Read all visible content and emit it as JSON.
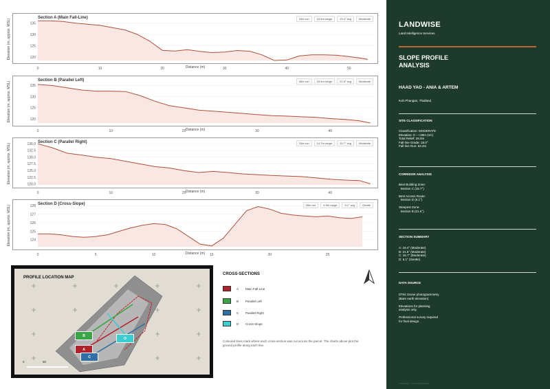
{
  "chart_data": [
    {
      "type": "area",
      "title": "Section A (Main Fall-Line)",
      "xlabel": "Distance (m)",
      "ylabel": "Elevation (m, approx. MSL)",
      "xlim": [
        0,
        54
      ],
      "ylim": [
        118.5,
        137
      ],
      "xticks": [
        0,
        10,
        20,
        30,
        40,
        50
      ],
      "yticks": [
        120,
        125,
        130,
        135
      ],
      "badges": [
        "33m run",
        "18.5m range",
        "19.4° avg",
        "Moderate"
      ],
      "x": [
        0,
        2,
        4,
        6,
        8,
        10,
        12,
        14,
        16,
        18,
        20,
        22,
        24,
        26,
        28,
        30,
        32,
        34,
        36,
        38,
        40,
        42,
        44,
        46,
        48,
        50,
        52,
        53
      ],
      "y": [
        136,
        136,
        135.7,
        135,
        134.5,
        134,
        133,
        132,
        130,
        127,
        123,
        122.7,
        123.3,
        122.5,
        122,
        122.2,
        122.9,
        122.6,
        121,
        118.5,
        118.7,
        120.5,
        121,
        121,
        120.8,
        120.2,
        119.5,
        119
      ]
    },
    {
      "type": "area",
      "title": "Section B (Parallel Left)",
      "xlabel": "Distance (m)",
      "ylabel": "Elevation (m, approx. MSL)",
      "xlim": [
        0,
        46
      ],
      "ylim": [
        118.2,
        137
      ],
      "xticks": [
        0,
        10,
        20,
        30,
        40
      ],
      "yticks": [
        120,
        125,
        130,
        135
      ],
      "badges": [
        "46m run",
        "18.4m range",
        "21.6° avg",
        "Moderate"
      ],
      "x": [
        0,
        2,
        4,
        6,
        8,
        10,
        12,
        14,
        16,
        18,
        20,
        22,
        24,
        26,
        28,
        30,
        32,
        34,
        36,
        38,
        40,
        42,
        44,
        45.5
      ],
      "y": [
        135.5,
        135,
        134,
        133,
        132.5,
        132.5,
        132.3,
        130.5,
        128,
        126,
        125,
        124,
        123.5,
        123,
        122.5,
        122,
        121.5,
        121.3,
        121,
        120.8,
        120.2,
        119.8,
        119.2,
        118.2
      ]
    },
    {
      "type": "area",
      "title": "Section C (Parallel Right)",
      "xlabel": "Distance (m)",
      "ylabel": "Elevation (m, approx. MSL)",
      "xlim": [
        0,
        46
      ],
      "ylim": [
        119.7,
        135.3
      ],
      "xticks": [
        0,
        10,
        20,
        30,
        40
      ],
      "yticks": [
        120.0,
        122.5,
        125.0,
        127.5,
        130.0,
        132.5,
        135.0
      ],
      "badges": [
        "33m run",
        "14.7m range",
        "15.7° avg",
        "Moderate"
      ],
      "x": [
        0,
        2,
        4,
        6,
        8,
        10,
        12,
        14,
        16,
        18,
        20,
        22,
        24,
        26,
        28,
        30,
        32,
        34,
        36,
        38,
        40,
        42,
        44,
        45.5
      ],
      "y": [
        135,
        133.5,
        131.5,
        130.8,
        130,
        129.5,
        128.5,
        127.5,
        126.5,
        126,
        125,
        124.3,
        124.7,
        124.3,
        123.8,
        123.5,
        123.2,
        123,
        122.8,
        122.3,
        121.8,
        121.5,
        121.3,
        120.1
      ]
    },
    {
      "type": "area",
      "title": "Section D (Cross-Slope)",
      "xlabel": "Distance (m)",
      "ylabel": "Elevation (m, approx. MSL)",
      "xlim": [
        0,
        29
      ],
      "ylim": [
        123.2,
        128.1
      ],
      "xticks": [
        0,
        5,
        10,
        15,
        20,
        25
      ],
      "yticks": [
        124,
        125,
        126,
        127,
        128
      ],
      "badges": [
        "28m run",
        "4.9m range",
        "6.1° avg",
        "Gentle"
      ],
      "x": [
        0,
        1,
        2,
        3,
        4,
        5,
        6,
        7,
        8,
        9,
        10,
        11,
        12,
        13,
        14,
        15,
        16,
        17,
        18,
        19,
        20,
        21,
        22,
        23,
        24,
        25,
        26,
        27,
        28
      ],
      "y": [
        124.7,
        124.7,
        124.6,
        124.4,
        124.3,
        124.4,
        124.6,
        125.0,
        125.4,
        125.7,
        125.9,
        125.8,
        125.3,
        124.4,
        123.5,
        123.3,
        124.2,
        125.8,
        127.4,
        127.9,
        127.6,
        127.1,
        126.9,
        126.8,
        126.7,
        126.8,
        126.6,
        126.5,
        126.7
      ]
    }
  ],
  "sidebar": {
    "brand": "LANDWISE",
    "tagline": "Land Intelligence Services",
    "title_line1": "SLOPE PROFILE",
    "title_line2": "ANALYSIS",
    "client": "HAAD YAO - ANIA & ARTEM",
    "location": "Koh Phangan, Thailand",
    "site_class_heading": "SITE CLASSIFICATION",
    "site_class_body": "Classification: MODERATE\nElevation: 0 – +28m (rel.)\nTotal Relief: 28.0m\nFall-line Grade: 18.0°\nFall-line Run: 53.2m",
    "corridor_heading": "CORRIDOR ANALYSIS",
    "corridor_body": "Best Building Zone:\n  Section C (15.7°)\n\nBest Access Route:\n  Section D (6.1°)\n\nSteepest Zone:\n  Section B (21.6°)",
    "summary_heading": "SECTION SUMMARY",
    "summary_body": "A: 19.4° (Moderate)\nB: 21.6° (Moderate)\nC: 15.7° (Moderate)\nD: 6.1° (Gentle)",
    "source_heading": "DATA SOURCE",
    "source_body": "DTM: Drone photogrammetry\n(Bare earth elevation)\n\nElevations for planning\nanalysis only.\n\nProfessional survey required\nfor final design.",
    "footer": "Landwise · Land Intelligence"
  },
  "map": {
    "title": "PROFILE LOCATION MAP",
    "scale_0": "0",
    "scale_50": "50",
    "labels": [
      "A",
      "B",
      "C",
      "D"
    ]
  },
  "legend": {
    "heading": "CROSS-SECTIONS",
    "items": [
      {
        "letter": "A",
        "label": "Main Fall-Line",
        "color": "#b3222a"
      },
      {
        "letter": "B",
        "label": "Parallel Left",
        "color": "#3aa545"
      },
      {
        "letter": "C",
        "label": "Parallel Right",
        "color": "#2f6fa6"
      },
      {
        "letter": "D",
        "label": "Cross-Slope",
        "color": "#3ccdd0"
      }
    ],
    "note": "Coloured lines mark where each cross-section was cut across the parcel. The charts above plot the ground profile along each line."
  },
  "colors": {
    "line": "#b0503a",
    "fill": "#f9e7e4",
    "sidebar": "#1e3a2c",
    "accent": "#c0692c"
  }
}
